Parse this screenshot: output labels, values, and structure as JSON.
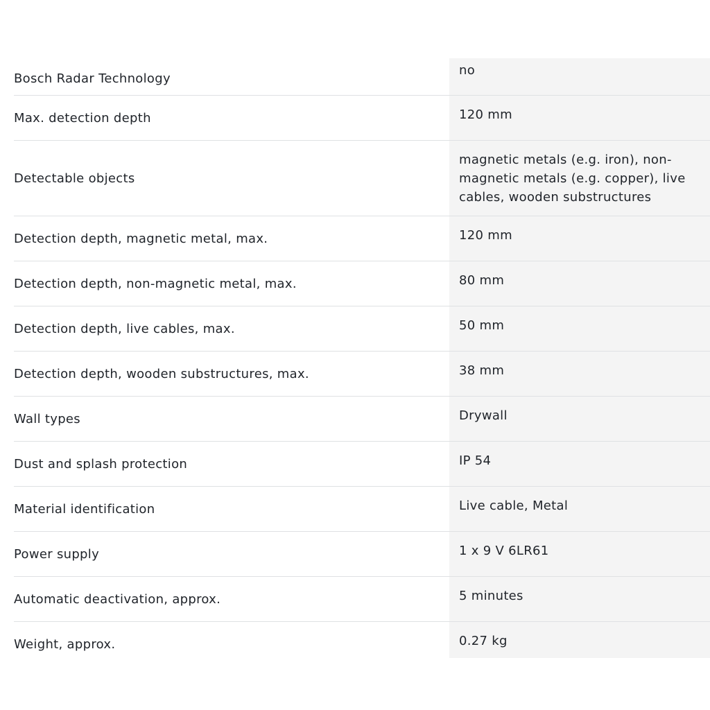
{
  "specs": [
    {
      "label": "Bosch Radar Technology",
      "value": "no"
    },
    {
      "label": "Max. detection depth",
      "value": "120 mm"
    },
    {
      "label": "Detectable objects",
      "value": "magnetic metals (e.g. iron), non-magnetic metals (e.g. copper), live cables, wooden substructures"
    },
    {
      "label": "Detection depth, magnetic metal, max.",
      "value": "120 mm"
    },
    {
      "label": "Detection depth, non-magnetic metal, max.",
      "value": "80 mm"
    },
    {
      "label": "Detection depth, live cables, max.",
      "value": "50 mm"
    },
    {
      "label": "Detection depth, wooden substructures, max.",
      "value": "38 mm"
    },
    {
      "label": "Wall types",
      "value": "Drywall"
    },
    {
      "label": "Dust and splash protection",
      "value": "IP 54"
    },
    {
      "label": "Material identification",
      "value": "Live cable, Metal"
    },
    {
      "label": "Power supply",
      "value": "1 x 9 V 6LR61"
    },
    {
      "label": "Automatic deactivation, approx.",
      "value": "5 minutes"
    },
    {
      "label": "Weight, approx.",
      "value": "0.27 kg"
    }
  ]
}
